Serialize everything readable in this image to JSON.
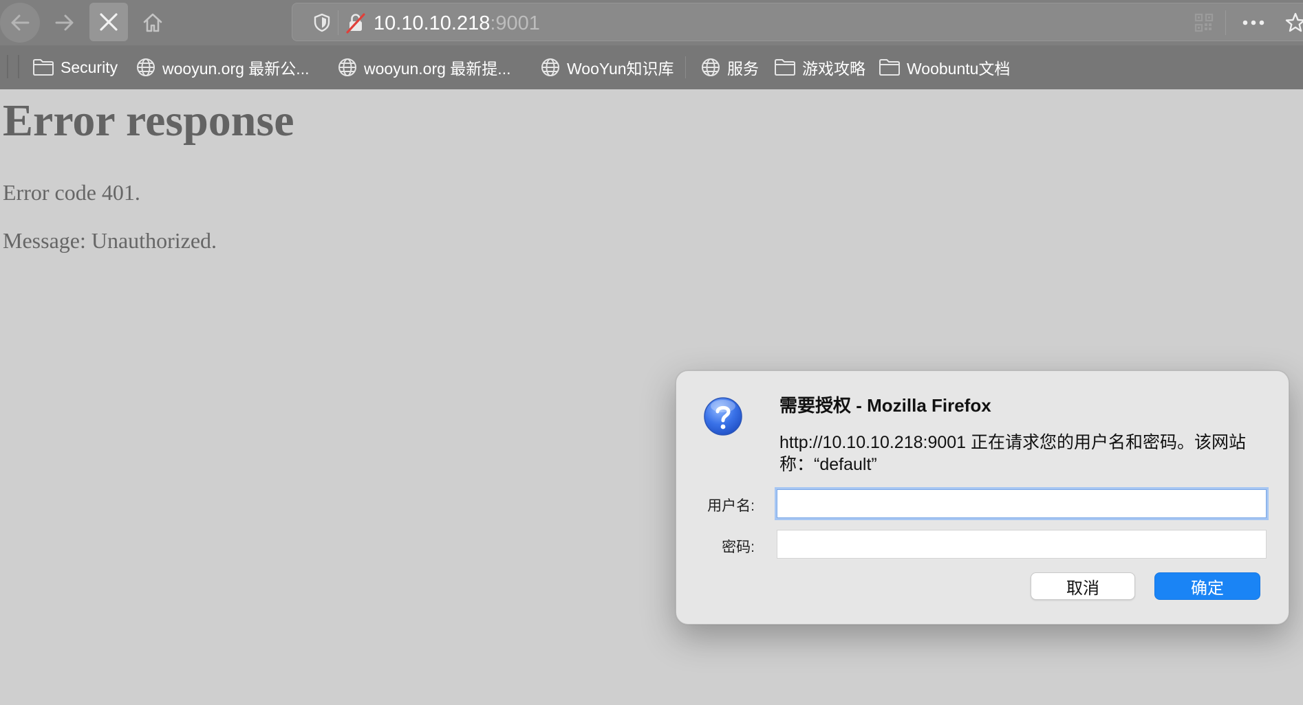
{
  "browser": {
    "url_host": "10.10.10.218",
    "url_port": ":9001",
    "toolbar": {
      "back_icon": "arrow-left-icon",
      "forward_icon": "arrow-right-icon",
      "stop_icon": "close-icon",
      "home_icon": "home-icon",
      "tracking_icon": "shield-icon",
      "insecure_icon": "insecure-lock-icon",
      "qr_icon": "qr-code-icon",
      "menu_icon": "more-icon",
      "bookmark_icon": "star-icon"
    },
    "bookmarks": [
      {
        "label": "Security",
        "icon": "folder-icon"
      },
      {
        "label": "wooyun.org 最新公...",
        "icon": "globe-icon"
      },
      {
        "label": "wooyun.org 最新提...",
        "icon": "globe-icon"
      },
      {
        "label": "WooYun知识库",
        "icon": "globe-icon"
      },
      {
        "label": "服务",
        "icon": "globe-icon"
      },
      {
        "label": "游戏攻略",
        "icon": "folder-icon"
      },
      {
        "label": "Woobuntu文档",
        "icon": "folder-icon"
      }
    ]
  },
  "page": {
    "title": "Error response",
    "error_code": "Error code 401.",
    "message": "Message: Unauthorized."
  },
  "dialog": {
    "icon": "question-icon",
    "title": "需要授权 - Mozilla Firefox",
    "message": "http://10.10.10.218:9001 正在请求您的用户名和密码。该网站称：“default”",
    "username_label": "用户名:",
    "username_value": "",
    "password_label": "密码:",
    "password_value": "",
    "cancel_label": "取消",
    "ok_label": "确定",
    "ok_color": "#1a84f5"
  }
}
